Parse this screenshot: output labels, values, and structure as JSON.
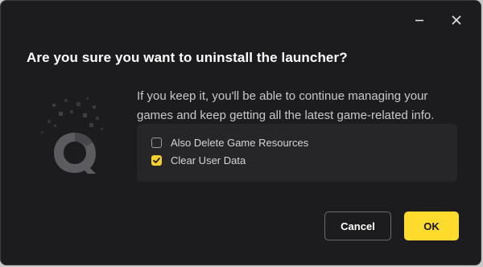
{
  "window": {
    "minimize_icon": "minimize-icon",
    "close_icon": "close-icon"
  },
  "dialog": {
    "title": "Are you sure you want to uninstall the launcher?",
    "description": "If you keep it, you'll be able to continue managing your games and keep getting all the latest game-related info.",
    "logo_icon": "launcher-logo-icon",
    "options": [
      {
        "label": "Also Delete Game Resources",
        "checked": false
      },
      {
        "label": "Clear User Data",
        "checked": true
      }
    ],
    "cancel_label": "Cancel",
    "ok_label": "OK"
  },
  "colors": {
    "background": "#1c1c1e",
    "panel": "#262628",
    "accent": "#fedb2c",
    "text_primary": "#ffffff",
    "text_secondary": "#c8c8cc"
  }
}
